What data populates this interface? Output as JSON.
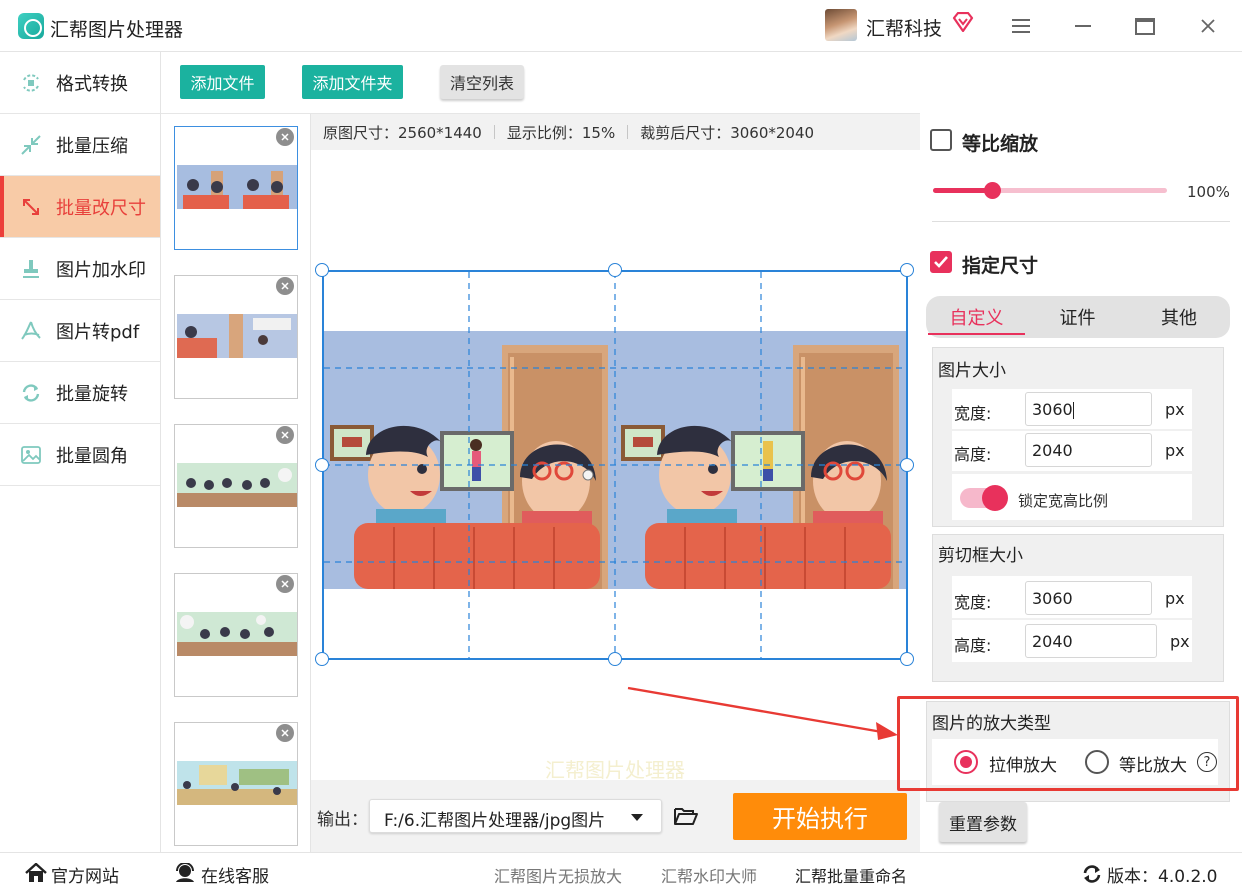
{
  "app": {
    "title": "汇帮图片处理器",
    "user_name": "汇帮科技"
  },
  "sidebar": {
    "items": [
      {
        "label": "格式转换",
        "icon": "convert-icon"
      },
      {
        "label": "批量压缩",
        "icon": "compress-icon"
      },
      {
        "label": "批量改尺寸",
        "icon": "resize-icon",
        "active": true
      },
      {
        "label": "图片加水印",
        "icon": "stamp-icon"
      },
      {
        "label": "图片转pdf",
        "icon": "pdf-icon"
      },
      {
        "label": "批量旋转",
        "icon": "rotate-icon"
      },
      {
        "label": "批量圆角",
        "icon": "image-icon"
      }
    ]
  },
  "toolbar": {
    "add_file": "添加文件",
    "add_folder": "添加文件夹",
    "clear_list": "清空列表"
  },
  "info": {
    "original_size": "原图尺寸：2560*1440",
    "display_ratio": "显示比例：15%",
    "cropped_size": "裁剪后尺寸：3060*2040"
  },
  "watermark_text": "汇帮图片处理器",
  "output": {
    "label": "输出：",
    "path": "F:/6.汇帮图片处理器/jpg图片",
    "start_button": "开始执行"
  },
  "right_panel": {
    "proportional_scale": {
      "label": "等比缩放",
      "checked": false,
      "value": 100,
      "value_text": "100%"
    },
    "specified_size": {
      "label": "指定尺寸",
      "checked": true
    },
    "tabs": [
      "自定义",
      "证件",
      "其他"
    ],
    "image_size": {
      "title": "图片大小",
      "width_label": "宽度:",
      "width_value": "3060",
      "height_label": "高度:",
      "height_value": "2040",
      "unit": "px",
      "lock_label": "锁定宽高比例"
    },
    "crop_size": {
      "title": "剪切框大小",
      "width_label": "宽度:",
      "width_value": "3060",
      "height_label": "高度:",
      "height_value": "2040",
      "unit": "px"
    },
    "enlarge_type": {
      "title": "图片的放大类型",
      "stretch": "拉伸放大",
      "proportional": "等比放大"
    },
    "reset_button": "重置参数"
  },
  "statusbar": {
    "official_site": "官方网站",
    "online_service": "在线客服",
    "links": [
      "汇帮图片无损放大",
      "汇帮水印大师",
      "汇帮批量重命名"
    ],
    "version": "版本：4.0.2.0"
  },
  "colors": {
    "accent": "#e8315c",
    "teal": "#1bb29f",
    "orange": "#ff8c0a",
    "selection_blue": "#2a83d8",
    "active_nav_bg": "#f8cba7"
  }
}
